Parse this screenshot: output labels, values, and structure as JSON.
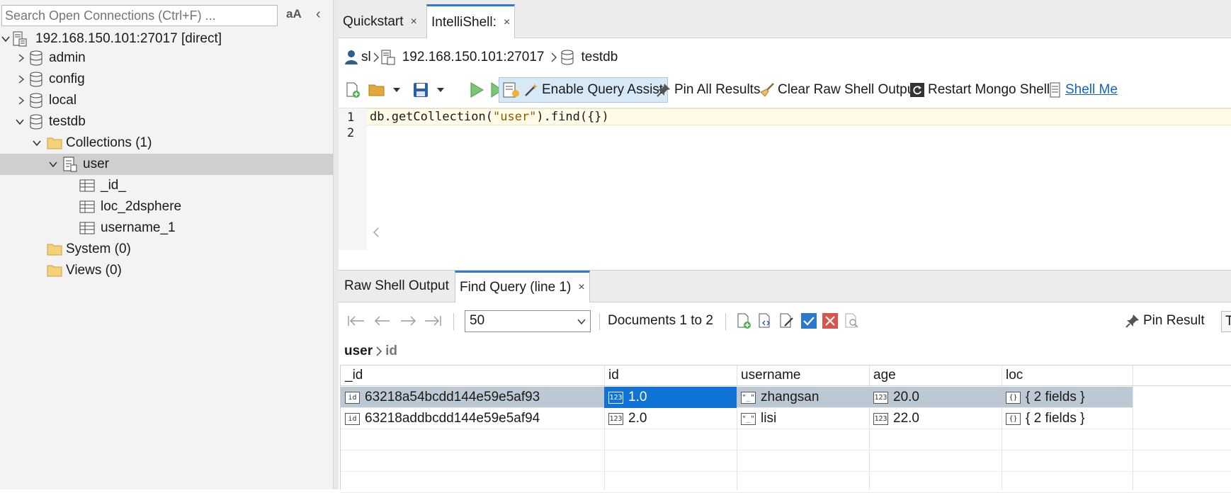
{
  "left": {
    "search_placeholder": "Search Open Connections (Ctrl+F) ...",
    "case_toggle": "aA",
    "collapse_glyph": "‹",
    "tree": [
      {
        "label": "192.168.150.101:27017 [direct]",
        "icon": "server-icon",
        "expanded": true
      },
      {
        "label": "admin",
        "icon": "database-icon",
        "expanded": false
      },
      {
        "label": "config",
        "icon": "database-icon",
        "expanded": false
      },
      {
        "label": "local",
        "icon": "database-icon",
        "expanded": false
      },
      {
        "label": "testdb",
        "icon": "database-icon",
        "expanded": true
      },
      {
        "label": "Collections (1)",
        "icon": "folder-icon",
        "expanded": true
      },
      {
        "label": "user",
        "icon": "collection-icon",
        "expanded": true,
        "selected": true
      },
      {
        "label": "_id_",
        "icon": "index-icon"
      },
      {
        "label": "loc_2dsphere",
        "icon": "index-icon"
      },
      {
        "label": "username_1",
        "icon": "index-icon"
      },
      {
        "label": "System (0)",
        "icon": "folder-icon"
      },
      {
        "label": "Views (0)",
        "icon": "folder-icon"
      }
    ]
  },
  "tabs": [
    {
      "label": "Quickstart",
      "close": "×"
    },
    {
      "label": "IntelliShell:",
      "close": "×",
      "active": true
    }
  ],
  "breadcrumb": {
    "user": "sl",
    "server": "192.168.150.101:27017",
    "database": "testdb"
  },
  "toolbar": {
    "query_assist": "Enable Query Assist",
    "pin_all": "Pin All Results",
    "clear_output": "Clear Raw Shell Output",
    "restart": "Restart Mongo Shell",
    "shell_menu": "Shell Me"
  },
  "editor": {
    "line_numbers": [
      "1",
      "2"
    ],
    "code_prefix": "db.getCollection(",
    "code_string": "\"user\"",
    "code_suffix": ").find({})"
  },
  "results_tabs": [
    {
      "label": "Raw Shell Output"
    },
    {
      "label": "Find Query (line 1)",
      "close": "×",
      "active": true
    }
  ],
  "results_toolbar": {
    "page_size": "50",
    "documents": "Documents 1 to 2",
    "pin_result": "Pin Result",
    "trailing": "T"
  },
  "path": {
    "collection": "user",
    "field": "id"
  },
  "grid": {
    "columns": [
      "_id",
      "id",
      "username",
      "age",
      "loc"
    ],
    "rows": [
      {
        "cells": [
          {
            "badge": "id",
            "value": "63218a54bcdd144e59e5af93"
          },
          {
            "badge": "123",
            "value": "1.0"
          },
          {
            "badge": "\"_\"",
            "value": "zhangsan"
          },
          {
            "badge": "123",
            "value": "20.0"
          },
          {
            "badge": "{}",
            "value": "{ 2 fields }"
          }
        ]
      },
      {
        "cells": [
          {
            "badge": "id",
            "value": "63218addbcdd144e59e5af94"
          },
          {
            "badge": "123",
            "value": "2.0"
          },
          {
            "badge": "\"_\"",
            "value": "lisi"
          },
          {
            "badge": "123",
            "value": "22.0"
          },
          {
            "badge": "{}",
            "value": "{ 2 fields }"
          }
        ]
      }
    ]
  },
  "colors": {
    "accent": "#2d7bd6",
    "selection": "#0f74d6",
    "row_selected": "#bcc8d3",
    "tree_selected": "#cfcfcf"
  }
}
